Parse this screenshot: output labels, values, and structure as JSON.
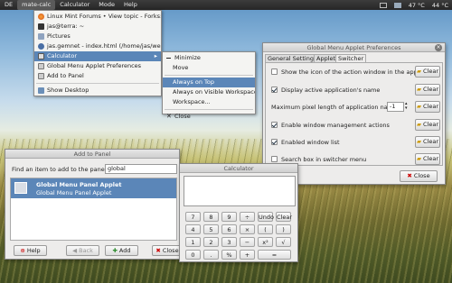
{
  "panel": {
    "items": [
      "DE",
      "mate-calc",
      "Calculator",
      "Mode",
      "Help"
    ],
    "tray": [
      "47 °C",
      "44 °C"
    ]
  },
  "window_menu": {
    "items": [
      {
        "label": "Linux Mint Forums • View topic - Forks: C...",
        "icon": "firefox-icon"
      },
      {
        "label": "jas@terra: ~",
        "icon": "terminal-icon"
      },
      {
        "label": "Pictures",
        "icon": "folder-icon"
      },
      {
        "label": "jas.gemnet - index.html (/home/jas/web...",
        "icon": "editor-icon"
      },
      {
        "label": "Calculator",
        "icon": "calculator-icon",
        "selected": true
      },
      {
        "label": "Global Menu Applet Preferences",
        "icon": "window-icon"
      },
      {
        "label": "Add to Panel",
        "icon": "window-icon"
      },
      {
        "label": "Show Desktop",
        "icon": "desktop-icon"
      }
    ]
  },
  "action_menu": {
    "items": [
      "Minimize",
      "Move",
      "Always on Top",
      "Always on Visible Workspace",
      "Workspace...",
      "Close"
    ],
    "selected": "Always on Top"
  },
  "prefs": {
    "title": "Global Menu Applet Preferences",
    "tabs": [
      "General Settings",
      "Applet",
      "Switcher"
    ],
    "active_tab": "Switcher",
    "rows": [
      {
        "label": "Show the icon of the action window in the applet",
        "checked": false,
        "button": "Clear"
      },
      {
        "label": "Display active application's name",
        "checked": true,
        "button": "Clear"
      },
      {
        "label": "Maximum pixel length of application name",
        "value": "-1",
        "button": "Clear"
      },
      {
        "label": "Enable window management actions",
        "checked": true,
        "button": "Clear"
      },
      {
        "label": "Enabled window list",
        "checked": true,
        "button": "Clear"
      },
      {
        "label": "Search box in switcher menu",
        "checked": false,
        "button": "Clear"
      }
    ],
    "close": "Close"
  },
  "add_panel": {
    "title": "Add to Panel",
    "find_label": "Find an item to add to the panel:",
    "search_value": "global",
    "item_title": "Global Menu Panel Applet",
    "item_desc": "Global Menu Panel Applet",
    "buttons": {
      "help": "Help",
      "back": "Back",
      "add": "Add",
      "close": "Close"
    }
  },
  "calculator": {
    "title": "Calculator",
    "keys": [
      [
        "7",
        "8",
        "9",
        "÷",
        "Undo",
        "Clear"
      ],
      [
        "4",
        "5",
        "6",
        "×",
        "(",
        ")"
      ],
      [
        "1",
        "2",
        "3",
        "−",
        "x²",
        "√"
      ],
      [
        "0",
        ".",
        "%",
        "+",
        "="
      ]
    ]
  }
}
